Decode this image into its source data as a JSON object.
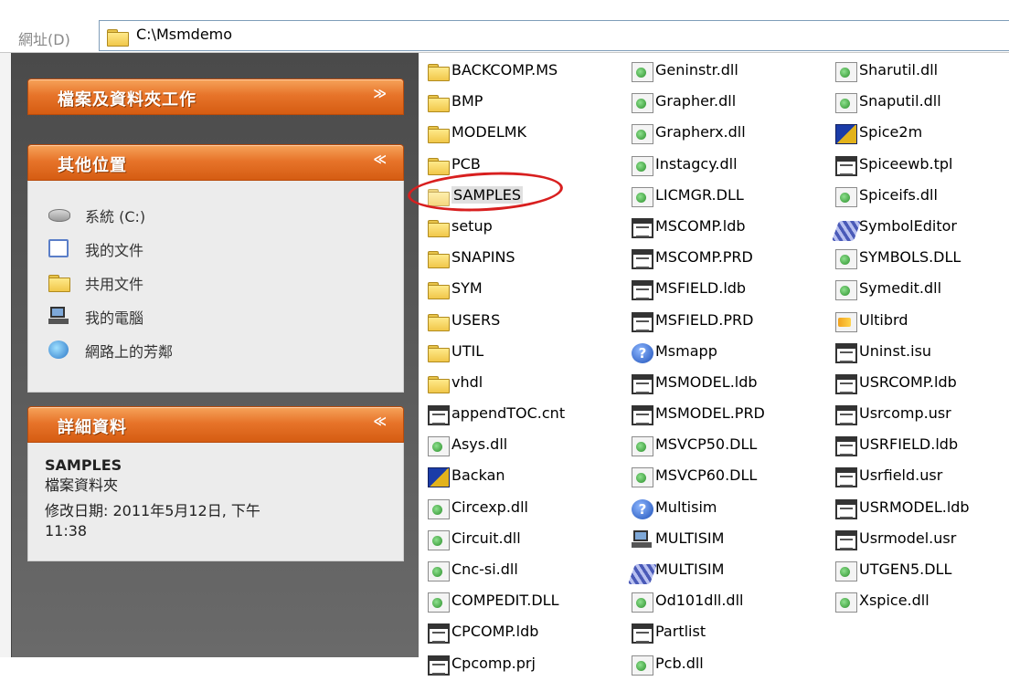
{
  "address_bar": {
    "label": "網址(D)",
    "path": "C:\\Msmdemo"
  },
  "task_pane": {
    "file_tasks": {
      "title": "檔案及資料夾工作",
      "toggle": "≫",
      "collapsed": true
    },
    "other_places": {
      "title": "其他位置",
      "toggle": "≪",
      "items": [
        {
          "label": "系統 (C:)",
          "icon": "drive-icon"
        },
        {
          "label": "我的文件",
          "icon": "my-documents-icon"
        },
        {
          "label": "共用文件",
          "icon": "shared-documents-icon"
        },
        {
          "label": "我的電腦",
          "icon": "my-computer-icon"
        },
        {
          "label": "網路上的芳鄰",
          "icon": "network-places-icon"
        }
      ]
    },
    "details": {
      "title": "詳細資料",
      "toggle": "≪",
      "name": "SAMPLES",
      "type": "檔案資料夾",
      "modified": "修改日期: 2011年5月12日, 下午",
      "modified_time": "11:38"
    }
  },
  "files": {
    "selected": "SAMPLES",
    "col1": [
      {
        "name": "BACKCOMP.MS",
        "icon": "folder"
      },
      {
        "name": "BMP",
        "icon": "folder"
      },
      {
        "name": "MODELMK",
        "icon": "folder"
      },
      {
        "name": "PCB",
        "icon": "folder"
      },
      {
        "name": "SAMPLES",
        "icon": "folder"
      },
      {
        "name": "setup",
        "icon": "folder"
      },
      {
        "name": "SNAPINS",
        "icon": "folder"
      },
      {
        "name": "SYM",
        "icon": "folder"
      },
      {
        "name": "USERS",
        "icon": "folder"
      },
      {
        "name": "UTIL",
        "icon": "folder"
      },
      {
        "name": "vhdl",
        "icon": "folder"
      },
      {
        "name": "appendTOC.cnt",
        "icon": "db"
      },
      {
        "name": "Asys.dll",
        "icon": "dll"
      },
      {
        "name": "Backan",
        "icon": "app"
      },
      {
        "name": "Circexp.dll",
        "icon": "dll"
      },
      {
        "name": "Circuit.dll",
        "icon": "dll"
      },
      {
        "name": "Cnc-si.dll",
        "icon": "dll"
      },
      {
        "name": "COMPEDIT.DLL",
        "icon": "dll"
      },
      {
        "name": "CPCOMP.ldb",
        "icon": "db"
      },
      {
        "name": "Cpcomp.prj",
        "icon": "db"
      }
    ],
    "col2": [
      {
        "name": "Geninstr.dll",
        "icon": "dll"
      },
      {
        "name": "Grapher.dll",
        "icon": "dll"
      },
      {
        "name": "Grapherx.dll",
        "icon": "dll"
      },
      {
        "name": "Instagcy.dll",
        "icon": "dll"
      },
      {
        "name": "LICMGR.DLL",
        "icon": "dll"
      },
      {
        "name": "MSCOMP.ldb",
        "icon": "db"
      },
      {
        "name": "MSCOMP.PRD",
        "icon": "db"
      },
      {
        "name": "MSFIELD.ldb",
        "icon": "db"
      },
      {
        "name": "MSFIELD.PRD",
        "icon": "db"
      },
      {
        "name": "Msmapp",
        "icon": "help"
      },
      {
        "name": "MSMODEL.ldb",
        "icon": "db"
      },
      {
        "name": "MSMODEL.PRD",
        "icon": "db"
      },
      {
        "name": "MSVCP50.DLL",
        "icon": "dll"
      },
      {
        "name": "MSVCP60.DLL",
        "icon": "dll"
      },
      {
        "name": "Multisim",
        "icon": "help"
      },
      {
        "name": "MULTISIM",
        "icon": "pc"
      },
      {
        "name": "MULTISIM",
        "icon": "gear"
      },
      {
        "name": "Od101dll.dll",
        "icon": "dll"
      },
      {
        "name": "Partlist",
        "icon": "db"
      },
      {
        "name": "Pcb.dll",
        "icon": "dll"
      }
    ],
    "col3": [
      {
        "name": "Sharutil.dll",
        "icon": "dll"
      },
      {
        "name": "Snaputil.dll",
        "icon": "dll"
      },
      {
        "name": "Spice2m",
        "icon": "app"
      },
      {
        "name": "Spiceewb.tpl",
        "icon": "db"
      },
      {
        "name": "Spiceifs.dll",
        "icon": "dll"
      },
      {
        "name": "SymbolEditor",
        "icon": "gear"
      },
      {
        "name": "SYMBOLS.DLL",
        "icon": "dll"
      },
      {
        "name": "Symedit.dll",
        "icon": "dll"
      },
      {
        "name": "Ultibrd",
        "icon": "setup"
      },
      {
        "name": "Uninst.isu",
        "icon": "db"
      },
      {
        "name": "USRCOMP.ldb",
        "icon": "db"
      },
      {
        "name": "Usrcomp.usr",
        "icon": "db"
      },
      {
        "name": "USRFIELD.ldb",
        "icon": "db"
      },
      {
        "name": "Usrfield.usr",
        "icon": "db"
      },
      {
        "name": "USRMODEL.ldb",
        "icon": "db"
      },
      {
        "name": "Usrmodel.usr",
        "icon": "db"
      },
      {
        "name": "UTGEN5.DLL",
        "icon": "dll"
      },
      {
        "name": "Xspice.dll",
        "icon": "dll"
      }
    ]
  },
  "colors": {
    "panel_header": "#e7742a",
    "panel_bg": "#ececec",
    "pane_bg": "#5a5a5a",
    "highlight": "#d81f1f"
  }
}
